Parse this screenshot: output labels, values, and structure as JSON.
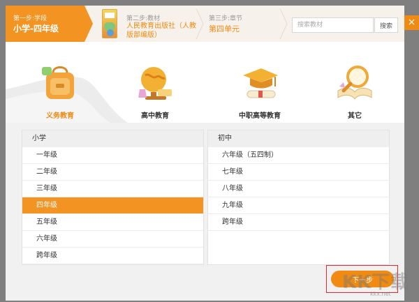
{
  "steps": {
    "step1": {
      "label": "第一步:学段",
      "value": "小学-四年级"
    },
    "step2": {
      "label": "第二步:教材",
      "value": "人民教育出版社（人教版部编版）"
    },
    "step3": {
      "label": "第三步:章节",
      "value": "第四单元"
    }
  },
  "search": {
    "placeholder": "搜索教材",
    "button_label": "搜索"
  },
  "close_label": "×",
  "categories": [
    {
      "label": "义务教育",
      "icon": "school-bag-icon",
      "active": true
    },
    {
      "label": "高中教育",
      "icon": "globe-microscope-icon",
      "active": false
    },
    {
      "label": "中职高等教育",
      "icon": "graduation-cap-icon",
      "active": false
    },
    {
      "label": "其它",
      "icon": "magnifier-book-icon",
      "active": false
    }
  ],
  "primary_panel": {
    "title": "小学",
    "grades": [
      "一年级",
      "二年级",
      "三年级",
      "四年级",
      "五年级",
      "六年级",
      "跨年级"
    ],
    "selected": "四年级"
  },
  "middle_panel": {
    "title": "初中",
    "grades": [
      "六年级（五四制）",
      "七年级",
      "八年级",
      "九年级",
      "跨年级"
    ]
  },
  "next_button_label": "下一步",
  "watermark": {
    "text": "KK下载",
    "url": "kkx.net"
  },
  "colors": {
    "accent": "#f08a12",
    "step_active": "#f39321",
    "header_bg": "#f6f1ea",
    "highlight_outline": "#e02a2a"
  }
}
